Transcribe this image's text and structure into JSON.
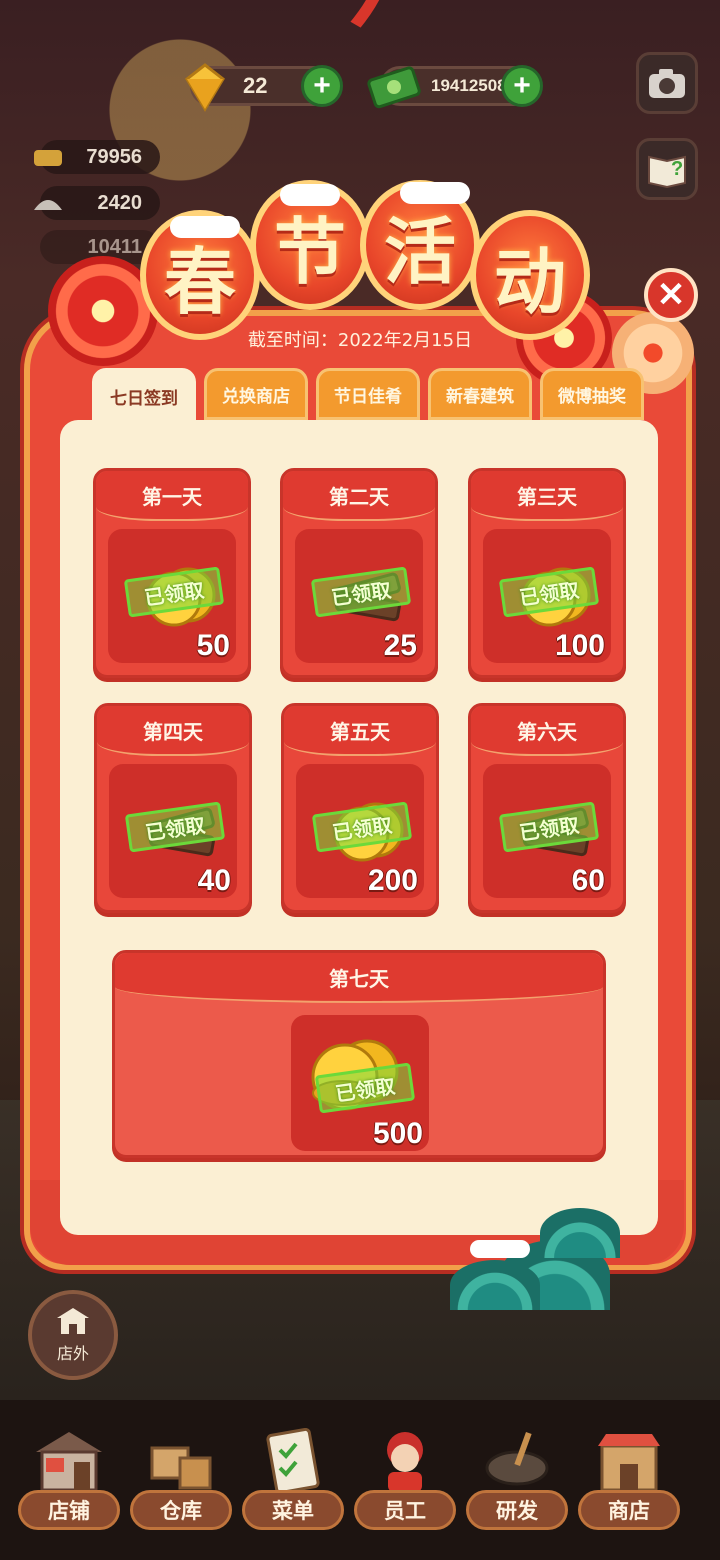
{
  "hud": {
    "diamonds": "22",
    "cash": "19412508",
    "stats": [
      "79956",
      "2420",
      "10411"
    ]
  },
  "event": {
    "title_chars": [
      "春",
      "节",
      "活",
      "动"
    ],
    "deadline": "截至时间：2022年2月15日",
    "close_glyph": "✕"
  },
  "tabs": [
    {
      "label": "七日签到",
      "active": true
    },
    {
      "label": "兑换商店",
      "active": false
    },
    {
      "label": "节日佳肴",
      "active": false
    },
    {
      "label": "新春建筑",
      "active": false
    },
    {
      "label": "微博抽奖",
      "active": false
    }
  ],
  "days": [
    {
      "label": "第一天",
      "reward": "coins",
      "amount": "50",
      "status": "已领取"
    },
    {
      "label": "第二天",
      "reward": "wood",
      "amount": "25",
      "status": "已领取"
    },
    {
      "label": "第三天",
      "reward": "coins",
      "amount": "100",
      "status": "已领取"
    },
    {
      "label": "第四天",
      "reward": "wood",
      "amount": "40",
      "status": "已领取"
    },
    {
      "label": "第五天",
      "reward": "coins",
      "amount": "200",
      "status": "已领取"
    },
    {
      "label": "第六天",
      "reward": "wood",
      "amount": "60",
      "status": "已领取"
    },
    {
      "label": "第七天",
      "reward": "coins",
      "amount": "500",
      "status": "已领取"
    }
  ],
  "outside": {
    "label": "店外"
  },
  "nav": [
    {
      "label": "店铺",
      "icon": "shop-building-icon"
    },
    {
      "label": "仓库",
      "icon": "warehouse-boxes-icon"
    },
    {
      "label": "菜单",
      "icon": "menu-clipboard-icon"
    },
    {
      "label": "员工",
      "icon": "staff-chef-icon"
    },
    {
      "label": "研发",
      "icon": "research-pot-icon"
    },
    {
      "label": "商店",
      "icon": "store-icon"
    }
  ],
  "colors": {
    "panel_red": "#e94a38",
    "panel_cream": "#fbefd3",
    "tab_orange": "#f39a2e",
    "stamp_green": "#6cd93a"
  }
}
